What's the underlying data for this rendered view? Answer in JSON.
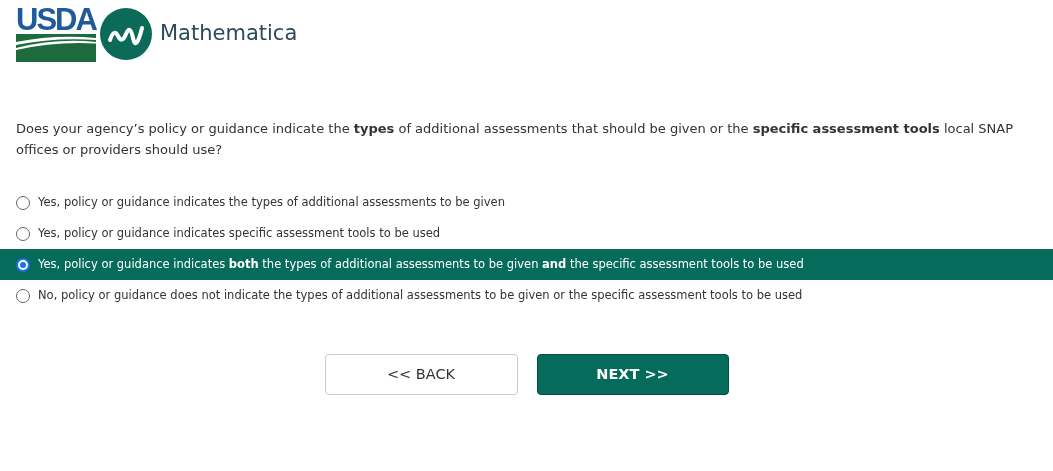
{
  "header": {
    "logos": [
      "USDA",
      "Mathematica"
    ]
  },
  "question": {
    "text": "Does your agency’s policy or guidance indicate the **types** of additional assessments that should be given or the **specific assessment tools** local SNAP offices or providers should use?"
  },
  "options": [
    {
      "label": "Yes, policy or guidance indicates the types of additional assessments to be given",
      "selected": false
    },
    {
      "label": "Yes, policy or guidance indicates specific assessment tools to be used",
      "selected": false
    },
    {
      "label": "Yes, policy or guidance indicates **both** the types of additional assessments to be given **and** the specific assessment tools to be used",
      "selected": true
    },
    {
      "label": "No, policy or guidance does not indicate the types of additional assessments to be given or the specific assessment tools to be used",
      "selected": false
    }
  ],
  "buttons": [
    {
      "label": "<< BACK",
      "kind": "secondary"
    },
    {
      "label": "NEXT >>",
      "kind": "primary"
    }
  ]
}
